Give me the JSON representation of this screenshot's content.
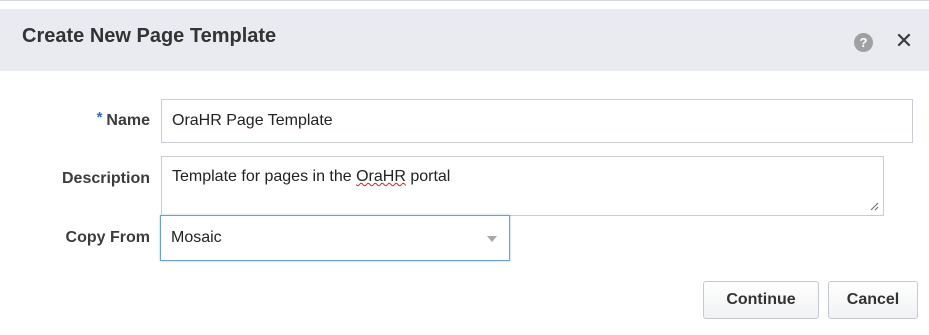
{
  "dialog": {
    "title": "Create New Page Template",
    "help_icon": "help-icon",
    "help_glyph": "?",
    "close_icon": "close-icon",
    "close_glyph": "✕"
  },
  "form": {
    "name": {
      "required_marker": "*",
      "label": "Name",
      "value": "OraHR Page Template"
    },
    "description": {
      "label": "Description",
      "value_before": "Template for pages in the ",
      "value_misspelled": "OraHR",
      "value_after": " portal"
    },
    "copy_from": {
      "label": "Copy From",
      "selected": "Mosaic"
    }
  },
  "buttons": {
    "continue": "Continue",
    "cancel": "Cancel"
  },
  "colors": {
    "header_bg": "#eaeaf1",
    "required_marker": "#2a6db5",
    "select_focus_border": "#6a9fd8"
  }
}
